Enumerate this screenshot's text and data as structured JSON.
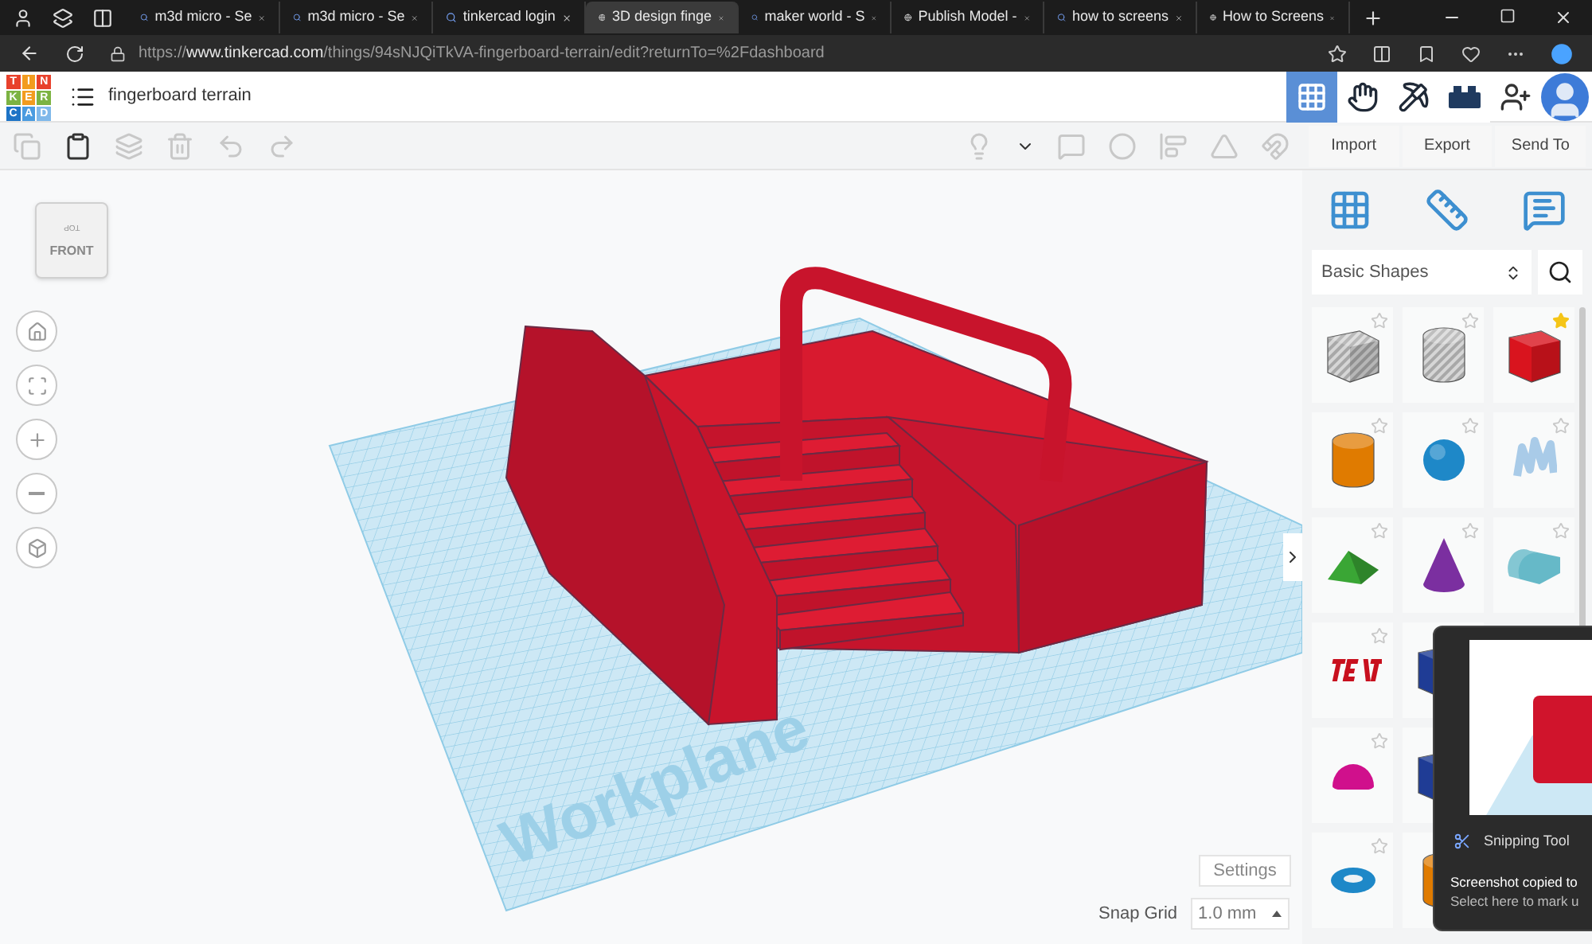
{
  "browser": {
    "tabs": [
      {
        "title": "m3d micro - Se",
        "kind": "search",
        "selected": false
      },
      {
        "title": "m3d micro - Se",
        "kind": "search",
        "selected": false
      },
      {
        "title": "tinkercad login",
        "kind": "search",
        "selected": false
      },
      {
        "title": "3D design finge",
        "kind": "site",
        "selected": true
      },
      {
        "title": "maker world - S",
        "kind": "search",
        "selected": false
      },
      {
        "title": "Publish Model -",
        "kind": "site",
        "selected": false
      },
      {
        "title": "how to screens",
        "kind": "search",
        "selected": false
      },
      {
        "title": "How to Screens",
        "kind": "site",
        "selected": false
      }
    ],
    "url": {
      "scheme": "https://",
      "host": "www.tinkercad.com",
      "path": "/things/94sNJQiTkVA-fingerboard-terrain/edit?returnTo=%2Fdashboard"
    }
  },
  "app": {
    "logo": [
      {
        "letter": "T",
        "color": "#e8412c"
      },
      {
        "letter": "I",
        "color": "#f29c1f"
      },
      {
        "letter": "N",
        "color": "#e8412c"
      },
      {
        "letter": "K",
        "color": "#7cb342"
      },
      {
        "letter": "E",
        "color": "#f29c1f"
      },
      {
        "letter": "R",
        "color": "#7cb342"
      },
      {
        "letter": "C",
        "color": "#1e74c6"
      },
      {
        "letter": "A",
        "color": "#4a9be0"
      },
      {
        "letter": "D",
        "color": "#7fb8ea"
      }
    ],
    "title": "fingerboard terrain",
    "modes": [
      {
        "kind": "grid",
        "selected": true
      },
      {
        "kind": "hand",
        "selected": false
      },
      {
        "kind": "pickaxe",
        "selected": false
      },
      {
        "kind": "brick",
        "selected": false
      }
    ]
  },
  "toolbar": [
    {
      "kind": "copy",
      "disabled": true
    },
    {
      "kind": "paste",
      "disabled": false
    },
    {
      "kind": "duplicate",
      "disabled": true
    },
    {
      "kind": "delete",
      "disabled": true
    },
    {
      "kind": "undo",
      "disabled": true
    },
    {
      "kind": "redo",
      "disabled": true
    }
  ],
  "viewport": {
    "view_cube": {
      "top": "TOP",
      "front": "FRONT"
    },
    "workplane_label": "Workplane",
    "settings": "Settings",
    "snap_grid": {
      "label": "Snap Grid",
      "value": "1.0 mm"
    }
  },
  "panel": {
    "actions": [
      "Import",
      "Export",
      "Send To"
    ],
    "category": "Basic Shapes",
    "shape_rows": [
      [
        {
          "kind": "box-hole",
          "color": "#c9c9c9",
          "favorite": false
        },
        {
          "kind": "cylinder-hole",
          "color": "#c9c9c9",
          "favorite": false
        },
        {
          "kind": "box",
          "color": "#d9141e",
          "favorite": true
        }
      ],
      [
        {
          "kind": "cylinder",
          "color": "#e07b00",
          "favorite": false
        },
        {
          "kind": "sphere",
          "color": "#1e88c8",
          "favorite": false
        },
        {
          "kind": "scribble",
          "color": "#a9cbe8",
          "favorite": false
        }
      ],
      [
        {
          "kind": "roof",
          "color": "#3aa635",
          "favorite": false
        },
        {
          "kind": "cone",
          "color": "#7b2fa0",
          "favorite": false
        },
        {
          "kind": "round-roof",
          "color": "#66b9c8",
          "favorite": false
        }
      ],
      [
        {
          "kind": "text",
          "color": "#c8101e",
          "favorite": false
        },
        {
          "kind": "box",
          "color": "#1f3c95"
        }
      ],
      [
        {
          "kind": "half-sphere",
          "color": "#d0108c",
          "favorite": false
        },
        {
          "kind": "box",
          "color": "#1f3c95"
        }
      ],
      [
        {
          "kind": "torus",
          "color": "#1e88c8",
          "favorite": false
        },
        {
          "kind": "cylinder",
          "color": "#e07b00"
        }
      ]
    ]
  },
  "toast": {
    "app": "Snipping Tool",
    "title": "Screenshot copied to",
    "body": "Select here to mark u"
  }
}
